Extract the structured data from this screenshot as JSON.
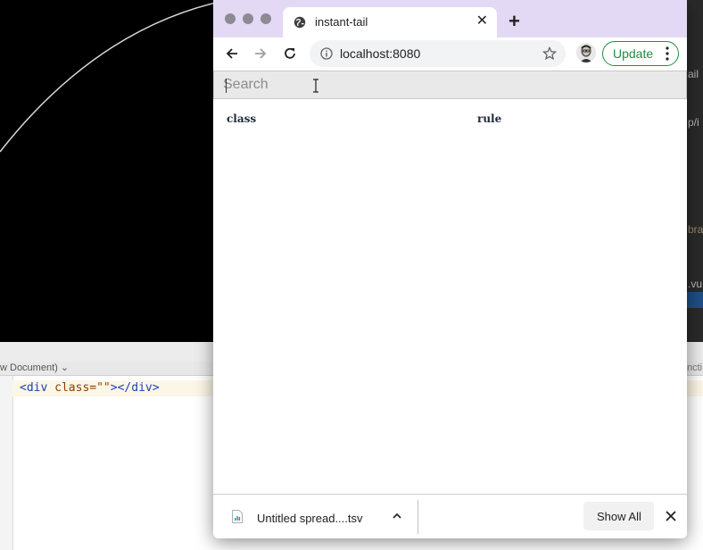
{
  "background": {
    "editor": {
      "doc_menu": "w Document) ⌄",
      "code_tag_open": "<div ",
      "code_attr": "class=",
      "code_string": "\"\"",
      "code_tag_close": "></div>"
    },
    "peek": {
      "text1": "ail",
      "text2": "p/i",
      "text3": "bra",
      "text4": ".vu",
      "text5": "ncti"
    }
  },
  "browser": {
    "tab": {
      "title": "instant-tail",
      "icon": "globe-icon"
    },
    "toolbar": {
      "url": "localhost:8080",
      "update_label": "Update"
    },
    "page": {
      "search_placeholder": "Search",
      "columns": [
        "class",
        "rule"
      ]
    },
    "downloads": {
      "file_name": "Untitled spread....tsv",
      "show_all_label": "Show All"
    }
  },
  "colors": {
    "tab_strip": "#e4d9f4",
    "update_accent": "#1e8e3e"
  }
}
